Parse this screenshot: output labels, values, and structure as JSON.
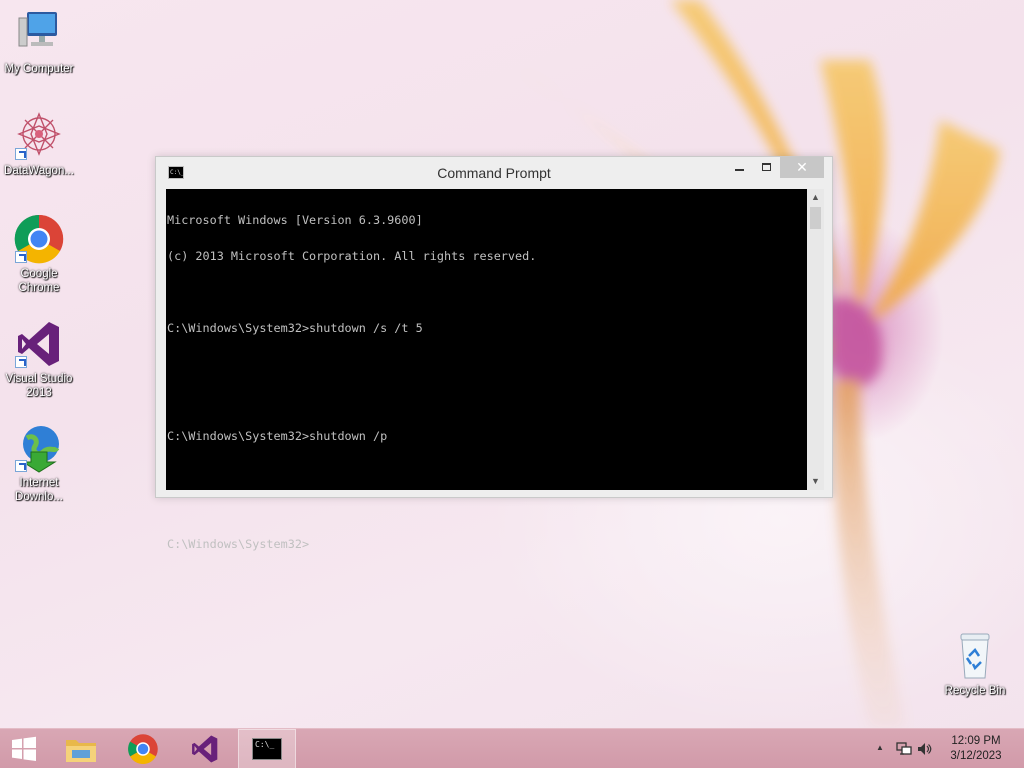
{
  "desktop": {
    "icons": [
      {
        "label": "My Computer",
        "icon": "computer-icon"
      },
      {
        "label": "DataWagon...",
        "icon": "datawagon-icon"
      },
      {
        "label": "Google Chrome",
        "icon": "chrome-icon"
      },
      {
        "label": "Visual Studio 2013",
        "icon": "visual-studio-icon"
      },
      {
        "label": "Internet Downlo...",
        "icon": "idm-icon"
      },
      {
        "label": "Recycle Bin",
        "icon": "recycle-bin-icon"
      }
    ]
  },
  "window": {
    "title": "Command Prompt",
    "minimize_glyph": "",
    "close_glyph": "✕",
    "console_lines": [
      "Microsoft Windows [Version 6.3.9600]",
      "(c) 2013 Microsoft Corporation. All rights reserved.",
      "",
      "C:\\Windows\\System32>shutdown /s /t 5",
      "",
      "",
      "C:\\Windows\\System32>shutdown /p",
      "",
      "",
      "C:\\Windows\\System32>"
    ],
    "icon_text": "C:\\_",
    "scroll_up": "▲",
    "scroll_down": "▼"
  },
  "taskbar": {
    "start_icon": "windows-logo-icon",
    "pinned": [
      {
        "name": "file-explorer-icon"
      },
      {
        "name": "chrome-icon"
      },
      {
        "name": "visual-studio-icon"
      },
      {
        "name": "command-prompt-icon"
      }
    ],
    "cmd_icon_text": "C:\\_",
    "tray": {
      "show_hidden": "▲"
    },
    "clock": {
      "time": "12:09 PM",
      "date": "3/12/2023"
    }
  },
  "colors": {
    "console_bg": "#000000",
    "console_fg": "#c0c0c0",
    "taskbar": "#d6a2b0",
    "close_button": "#c7c7c7"
  }
}
